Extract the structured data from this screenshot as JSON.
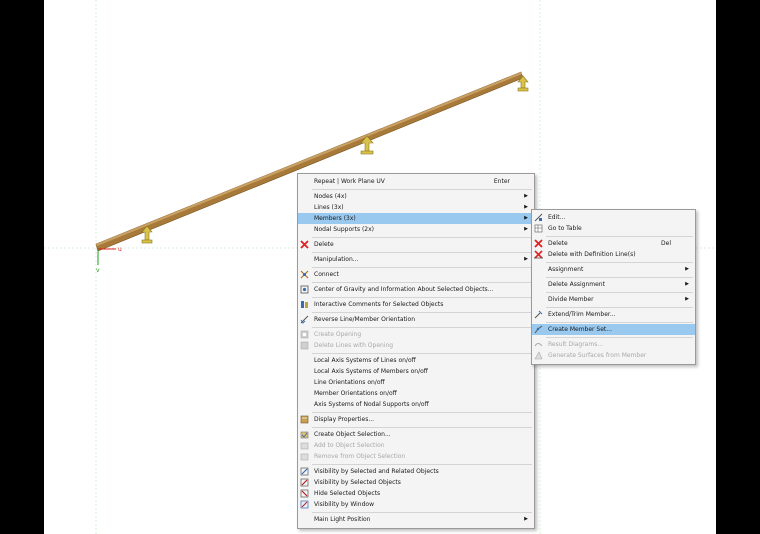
{
  "axes": {
    "u": "u",
    "v": "v"
  },
  "context_menu": {
    "items": [
      {
        "label": "Repeat | Work Plane UV",
        "shortcut": "Enter",
        "icon": "",
        "submenu": false,
        "disabled": false,
        "highlighted": false,
        "sep_before": false
      },
      {
        "label": "Nodes (4x)",
        "shortcut": "",
        "icon": "",
        "submenu": true,
        "disabled": false,
        "highlighted": false,
        "sep_before": true
      },
      {
        "label": "Lines (3x)",
        "shortcut": "",
        "icon": "",
        "submenu": true,
        "disabled": false,
        "highlighted": false,
        "sep_before": false
      },
      {
        "label": "Members (3x)",
        "shortcut": "",
        "icon": "",
        "submenu": true,
        "disabled": false,
        "highlighted": true,
        "sep_before": false
      },
      {
        "label": "Nodal Supports (2x)",
        "shortcut": "",
        "icon": "",
        "submenu": true,
        "disabled": false,
        "highlighted": false,
        "sep_before": false
      },
      {
        "label": "Delete",
        "shortcut": "",
        "icon": "delete-icon",
        "submenu": false,
        "disabled": false,
        "highlighted": false,
        "sep_before": true
      },
      {
        "label": "Manipulation...",
        "shortcut": "",
        "icon": "",
        "submenu": true,
        "disabled": false,
        "highlighted": false,
        "sep_before": true
      },
      {
        "label": "Connect",
        "shortcut": "",
        "icon": "connect-icon",
        "submenu": false,
        "disabled": false,
        "highlighted": false,
        "sep_before": true
      },
      {
        "label": "Center of Gravity and Information About Selected Objects...",
        "shortcut": "",
        "icon": "center-of-gravity-icon",
        "submenu": false,
        "disabled": false,
        "highlighted": false,
        "sep_before": true
      },
      {
        "label": "Interactive Comments for Selected Objects",
        "shortcut": "",
        "icon": "comments-icon",
        "submenu": false,
        "disabled": false,
        "highlighted": false,
        "sep_before": true
      },
      {
        "label": "Reverse Line/Member Orientation",
        "shortcut": "",
        "icon": "reverse-orientation-icon",
        "submenu": false,
        "disabled": false,
        "highlighted": false,
        "sep_before": true
      },
      {
        "label": "Create Opening",
        "shortcut": "",
        "icon": "create-opening-icon",
        "submenu": false,
        "disabled": true,
        "highlighted": false,
        "sep_before": true
      },
      {
        "label": "Delete Lines with Opening",
        "shortcut": "",
        "icon": "delete-lines-opening-icon",
        "submenu": false,
        "disabled": true,
        "highlighted": false,
        "sep_before": false
      },
      {
        "label": "Local Axis Systems of Lines on/off",
        "shortcut": "",
        "icon": "",
        "submenu": false,
        "disabled": false,
        "highlighted": false,
        "sep_before": true
      },
      {
        "label": "Local Axis Systems of Members on/off",
        "shortcut": "",
        "icon": "",
        "submenu": false,
        "disabled": false,
        "highlighted": false,
        "sep_before": false
      },
      {
        "label": "Line Orientations on/off",
        "shortcut": "",
        "icon": "",
        "submenu": false,
        "disabled": false,
        "highlighted": false,
        "sep_before": false
      },
      {
        "label": "Member Orientations on/off",
        "shortcut": "",
        "icon": "",
        "submenu": false,
        "disabled": false,
        "highlighted": false,
        "sep_before": false
      },
      {
        "label": "Axis Systems of Nodal Supports on/off",
        "shortcut": "",
        "icon": "",
        "submenu": false,
        "disabled": false,
        "highlighted": false,
        "sep_before": false
      },
      {
        "label": "Display Properties...",
        "shortcut": "",
        "icon": "display-properties-icon",
        "submenu": false,
        "disabled": false,
        "highlighted": false,
        "sep_before": true
      },
      {
        "label": "Create Object Selection...",
        "shortcut": "",
        "icon": "create-selection-icon",
        "submenu": false,
        "disabled": false,
        "highlighted": false,
        "sep_before": true
      },
      {
        "label": "Add to Object Selection",
        "shortcut": "",
        "icon": "add-selection-icon",
        "submenu": false,
        "disabled": true,
        "highlighted": false,
        "sep_before": false
      },
      {
        "label": "Remove from Object Selection",
        "shortcut": "",
        "icon": "remove-selection-icon",
        "submenu": false,
        "disabled": true,
        "highlighted": false,
        "sep_before": false
      },
      {
        "label": "Visibility by Selected and Related Objects",
        "shortcut": "",
        "icon": "visibility-related-icon",
        "submenu": false,
        "disabled": false,
        "highlighted": false,
        "sep_before": true
      },
      {
        "label": "Visibility by Selected Objects",
        "shortcut": "",
        "icon": "visibility-selected-icon",
        "submenu": false,
        "disabled": false,
        "highlighted": false,
        "sep_before": false
      },
      {
        "label": "Hide Selected Objects",
        "shortcut": "",
        "icon": "hide-selected-icon",
        "submenu": false,
        "disabled": false,
        "highlighted": false,
        "sep_before": false
      },
      {
        "label": "Visibility by Window",
        "shortcut": "",
        "icon": "visibility-window-icon",
        "submenu": false,
        "disabled": false,
        "highlighted": false,
        "sep_before": false
      },
      {
        "label": "Main Light Position",
        "shortcut": "",
        "icon": "",
        "submenu": true,
        "disabled": false,
        "highlighted": false,
        "sep_before": true
      }
    ]
  },
  "submenu": {
    "items": [
      {
        "label": "Edit...",
        "shortcut": "",
        "icon": "edit-member-icon",
        "submenu": false,
        "disabled": false,
        "highlighted": false,
        "sep_before": false
      },
      {
        "label": "Go to Table",
        "shortcut": "",
        "icon": "go-to-table-icon",
        "submenu": false,
        "disabled": false,
        "highlighted": false,
        "sep_before": false
      },
      {
        "label": "Delete",
        "shortcut": "Del",
        "icon": "delete-icon",
        "submenu": false,
        "disabled": false,
        "highlighted": false,
        "sep_before": true
      },
      {
        "label": "Delete with Definition Line(s)",
        "shortcut": "",
        "icon": "delete-with-line-icon",
        "submenu": false,
        "disabled": false,
        "highlighted": false,
        "sep_before": false
      },
      {
        "label": "Assignment",
        "shortcut": "",
        "icon": "",
        "submenu": true,
        "disabled": false,
        "highlighted": false,
        "sep_before": true
      },
      {
        "label": "Delete Assignment",
        "shortcut": "",
        "icon": "",
        "submenu": true,
        "disabled": false,
        "highlighted": false,
        "sep_before": true
      },
      {
        "label": "Divide Member",
        "shortcut": "",
        "icon": "",
        "submenu": true,
        "disabled": false,
        "highlighted": false,
        "sep_before": true
      },
      {
        "label": "Extend/Trim Member...",
        "shortcut": "",
        "icon": "extend-trim-icon",
        "submenu": false,
        "disabled": false,
        "highlighted": false,
        "sep_before": true
      },
      {
        "label": "Create Member Set...",
        "shortcut": "",
        "icon": "member-set-icon",
        "submenu": false,
        "disabled": false,
        "highlighted": true,
        "sep_before": true
      },
      {
        "label": "Result Diagrams...",
        "shortcut": "",
        "icon": "result-diagrams-icon",
        "submenu": false,
        "disabled": true,
        "highlighted": false,
        "sep_before": true
      },
      {
        "label": "Generate Surfaces from Member",
        "shortcut": "",
        "icon": "generate-surfaces-icon",
        "submenu": false,
        "disabled": true,
        "highlighted": false,
        "sep_before": false
      }
    ]
  },
  "colors": {
    "beam": "#a87a3a",
    "beam_top": "#c9a064",
    "beam_edge": "#7a5420",
    "support": "#d8c24a",
    "support_dark": "#8d7a1e",
    "highlight": "#99c9ef",
    "grid": "#d9f1d9",
    "axis_red": "#e02020",
    "axis_green": "#209a20"
  }
}
